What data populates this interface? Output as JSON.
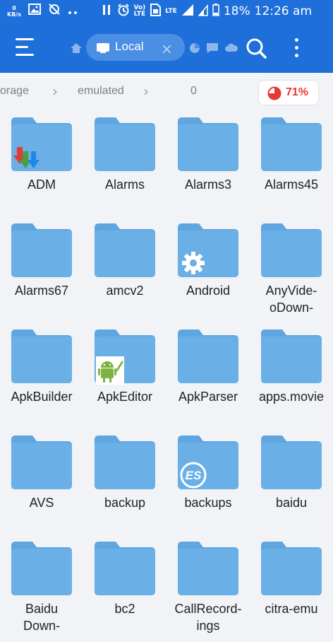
{
  "status_bar": {
    "speed_value": "0",
    "speed_unit": "KB/s",
    "volte": "Vo)\nLTE",
    "lte": "LTE",
    "battery": "18%",
    "time": "12:26 am"
  },
  "toolbar": {
    "tab_label": "Local",
    "tab_close": "×"
  },
  "breadcrumb": {
    "items": [
      "orage",
      "emulated",
      "0"
    ],
    "storage_percent": "71%"
  },
  "folders": [
    {
      "name": "ADM",
      "badge": "adm"
    },
    {
      "name": "Alarms",
      "badge": ""
    },
    {
      "name": "Alarms3",
      "badge": ""
    },
    {
      "name": "Alarms45",
      "badge": ""
    },
    {
      "name": "Alarms67",
      "badge": ""
    },
    {
      "name": "amcv2",
      "badge": ""
    },
    {
      "name": "Android",
      "badge": "gear"
    },
    {
      "name": "AnyVide-\noDown-",
      "badge": ""
    },
    {
      "name": "ApkBuilder",
      "badge": ""
    },
    {
      "name": "ApkEditor",
      "badge": "android"
    },
    {
      "name": "ApkParser",
      "badge": ""
    },
    {
      "name": "apps.movie",
      "badge": ""
    },
    {
      "name": "AVS",
      "badge": ""
    },
    {
      "name": "backup",
      "badge": ""
    },
    {
      "name": "backups",
      "badge": "es"
    },
    {
      "name": "baidu",
      "badge": ""
    },
    {
      "name": "Baidu\nDown-",
      "badge": ""
    },
    {
      "name": "bc2",
      "badge": ""
    },
    {
      "name": "CallRecord-\nings",
      "badge": ""
    },
    {
      "name": "citra-emu",
      "badge": ""
    }
  ],
  "colors": {
    "toolbar": "#1e6fd9",
    "folder": "#6aafe6",
    "folder_tab": "#5fa6e1",
    "accent_red": "#e53935"
  }
}
